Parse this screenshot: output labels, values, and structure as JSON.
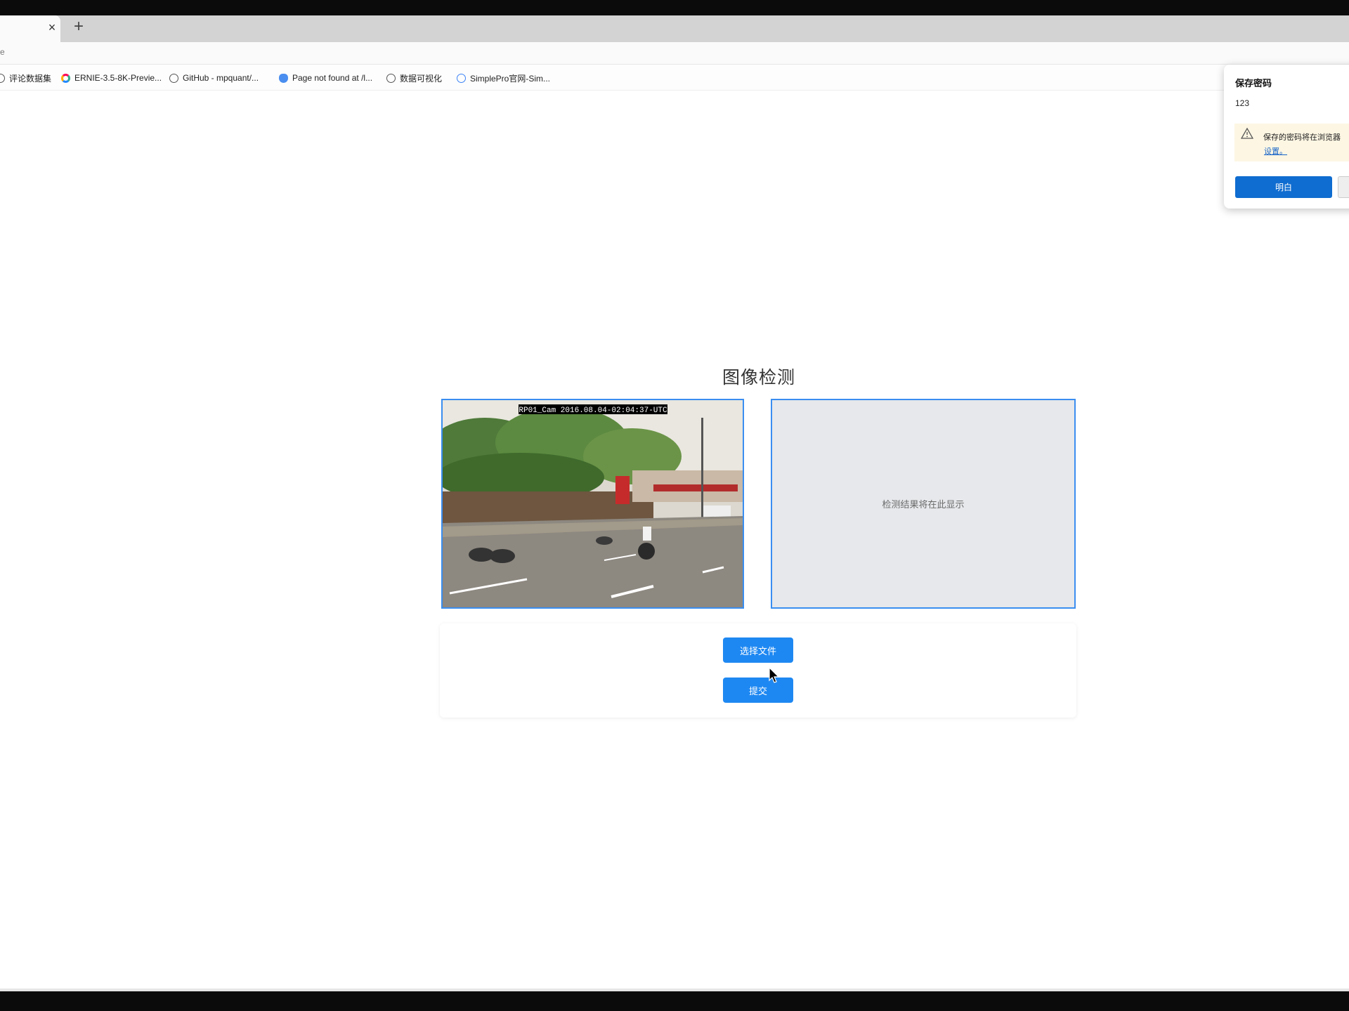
{
  "browser": {
    "tab_close": "×",
    "new_tab": "+",
    "address": "e",
    "bookmarks": [
      {
        "label": "评论数据集",
        "icon": "globe-icon"
      },
      {
        "label": "ERNIE-3.5-8K-Previe...",
        "icon": "ernie-logo-icon"
      },
      {
        "label": "GitHub - mpquant/...",
        "icon": "globe-icon"
      },
      {
        "label": "Page not found at /l...",
        "icon": "paw-icon"
      },
      {
        "label": "数据可视化",
        "icon": "globe-icon"
      },
      {
        "label": "SimplePro官网-Sim...",
        "icon": "simplepro-icon"
      }
    ]
  },
  "page": {
    "title": "图像检测",
    "image_caption": "RP01_Cam 2016.08.04-02:04:37-UTC",
    "result_placeholder": "检测结果将在此显示",
    "choose_button": "选择文件",
    "submit_button": "提交"
  },
  "password_popup": {
    "title": "保存密码",
    "username": "123",
    "warning": "保存的密码将在浏览器",
    "settings_link": "设置。",
    "ok_button": "明白"
  },
  "colors": {
    "accent": "#1e88f2",
    "popup_button": "#0f6cd0",
    "border_blue": "#3a8ef0"
  }
}
